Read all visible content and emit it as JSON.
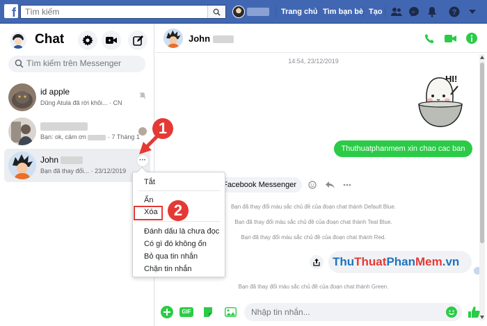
{
  "topbar": {
    "logo": "f",
    "search_placeholder": "Tìm kiếm",
    "nav": [
      "Trang chủ",
      "Tìm bạn bè",
      "Tạo"
    ],
    "colors": {
      "bar": "#4267b2"
    }
  },
  "sidebar": {
    "title": "Chat",
    "search_placeholder": "Tìm kiếm trên Messenger",
    "conversations": [
      {
        "name": "id apple",
        "preview": "Dũng Atula đã rời khỏi...",
        "time": "· CN",
        "icon": "mute-bell-icon"
      },
      {
        "name": "",
        "preview": "Bạn: ok, cảm ơn",
        "time": "· 7 Tháng 1"
      },
      {
        "name": "John",
        "preview": "Bạn đã thay đổi...",
        "time": "· 23/12/2019"
      }
    ],
    "more_label": "···"
  },
  "context_menu": {
    "items": [
      "Tắt",
      "Ẩn",
      "Xóa",
      "Đánh dấu là chưa đọc",
      "Có gì đó không ổn",
      "Bỏ qua tin nhắn",
      "Chặn tin nhắn"
    ]
  },
  "annotations": {
    "step1": "1",
    "step2": "2"
  },
  "chat": {
    "name": "John",
    "timestamp": "14:54, 23/12/2019",
    "sticker_text": "HI!",
    "sent_message": "Thuthuatphanmem xin chao cac ban",
    "received_message": "Facebook Messenger",
    "system_messages": [
      "Bạn đã thay đổi màu sắc chủ đề của đoạn chat thành Default Blue.",
      "Bạn đã thay đổi màu sắc chủ đề của đoạn chat thành Teal Blue.",
      "Bạn đã thay đổi màu sắc chủ đề của đoạn chat thành Red.",
      "Bạn đã thay đổi màu sắc chủ đề của đoạn chat thành Green."
    ],
    "watermark_parts": [
      "Thu",
      "Thuat",
      "Phan",
      "Mem",
      ".vn"
    ],
    "composer_placeholder": "Nhập tin nhắn...",
    "gif_label": "GIF",
    "colors": {
      "accent": "#2bcb47",
      "bubble_gray": "#f0f2f5",
      "annotation_red": "#e53935"
    }
  }
}
